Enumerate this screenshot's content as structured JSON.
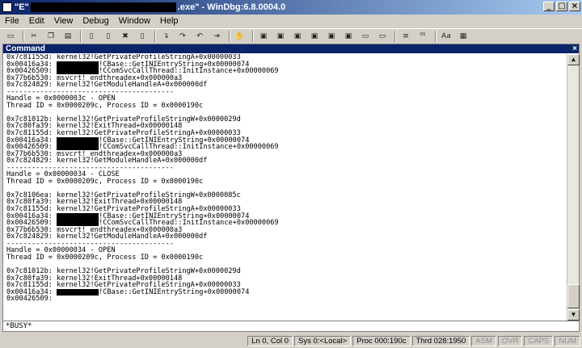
{
  "titlebar": {
    "title_prefix": "\"E\"",
    "title_suffix": ".exe\" - WinDbg:6.8.0004.0"
  },
  "menu": [
    "File",
    "Edit",
    "View",
    "Debug",
    "Window",
    "Help"
  ],
  "toolbar": {
    "buttons": [
      "open",
      "cut",
      "copy",
      "paste",
      "go",
      "restart",
      "stop",
      "break",
      "step-into",
      "step-over",
      "step-out",
      "run-to-cursor",
      "hand",
      "command",
      "watch",
      "locals",
      "registers",
      "memory",
      "call-stack",
      "disassembly",
      "scratchpad",
      "source-mode",
      "hex",
      "font",
      "options"
    ]
  },
  "command_window": {
    "title": "Command",
    "lines": [
      {
        "addr": "0x7c81155d:",
        "text": "kernel32!GetPrivateProfileStringA+0x00000033"
      },
      {
        "addr": "0x00416a34:",
        "redacted": true,
        "text": "!CBase::GetINIEntryString+0x00000074"
      },
      {
        "addr": "0x00426509:",
        "redacted": true,
        "text": "!CComSvcCallThread::InitInstance+0x00000069"
      },
      {
        "addr": "0x77b6b530:",
        "text": "msvcrt!_endthreadex+0x000000a3"
      },
      {
        "addr": "0x7c824829:",
        "text": "kernel32!GetModuleHandleA+0x000000df"
      },
      {
        "text": "----------------------------------------"
      },
      {
        "text": "Handle = 0x0000003c - OPEN"
      },
      {
        "text": "Thread ID = 0x0000209c, Process ID = 0x0000190c"
      },
      {
        "text": ""
      },
      {
        "addr": "0x7c81012b:",
        "text": "kernel32!GetPrivateProfileStringW+0x0000029d"
      },
      {
        "addr": "0x7c80fa39:",
        "text": "kernel32!ExitThread+0x00000148"
      },
      {
        "addr": "0x7c81155d:",
        "text": "kernel32!GetPrivateProfileStringA+0x00000033"
      },
      {
        "addr": "0x00416a34:",
        "redacted": true,
        "text": "!CBase::GetINIEntryString+0x00000074"
      },
      {
        "addr": "0x00426509:",
        "redacted": true,
        "text": "!CComSvcCallThread::InitInstance+0x00000069"
      },
      {
        "addr": "0x77b6b530:",
        "text": "msvcrt!_endthreadex+0x000000a3"
      },
      {
        "addr": "0x7c824829:",
        "text": "kernel32!GetModuleHandleA+0x000000df"
      },
      {
        "text": "----------------------------------------"
      },
      {
        "text": "Handle = 0x00000034 - CLOSE"
      },
      {
        "text": "Thread ID = 0x0000209c, Process ID = 0x0000190c"
      },
      {
        "text": ""
      },
      {
        "addr": "0x7c8106ea:",
        "text": "kernel32!GetPrivateProfileStringW+0x0000085c"
      },
      {
        "addr": "0x7c80fa39:",
        "text": "kernel32!ExitThread+0x00000148"
      },
      {
        "addr": "0x7c81155d:",
        "text": "kernel32!GetPrivateProfileStringA+0x00000033"
      },
      {
        "addr": "0x00416a34:",
        "redacted": true,
        "text": "!CBase::GetINIEntryString+0x00000074"
      },
      {
        "addr": "0x00426509:",
        "redacted": true,
        "text": "!CComSvcCallThread::InitInstance+0x00000069"
      },
      {
        "addr": "0x77b6b530:",
        "text": "msvcrt!_endthreadex+0x000000a3"
      },
      {
        "addr": "0x7c824829:",
        "text": "kernel32!GetModuleHandleA+0x000000df"
      },
      {
        "text": "----------------------------------------"
      },
      {
        "text": "Handle = 0x00000034 - OPEN"
      },
      {
        "text": "Thread ID = 0x0000209c, Process ID = 0x0000190c"
      },
      {
        "text": ""
      },
      {
        "addr": "0x7c81012b:",
        "text": "kernel32!GetPrivateProfileStringW+0x0000029d"
      },
      {
        "addr": "0x7c80fa39:",
        "text": "kernel32!ExitThread+0x00000148"
      },
      {
        "addr": "0x7c81155d:",
        "text": "kernel32!GetPrivateProfileStringA+0x00000033"
      },
      {
        "addr": "0x00416a34:",
        "redacted": true,
        "text": "!CBase::GetINIEntryString+0x00000074"
      },
      {
        "addr": "0x00426509:",
        "text": ""
      }
    ],
    "input_prompt": "*BUSY*"
  },
  "statusbar": {
    "cursor": "Ln 0, Col 0",
    "sys": "Sys 0:<Local>",
    "proc": "Proc 000:190c",
    "thrd": "Thrd 028:1950",
    "asm": "ASM",
    "ovr": "OVR",
    "caps": "CAPS",
    "num": "NUM"
  }
}
